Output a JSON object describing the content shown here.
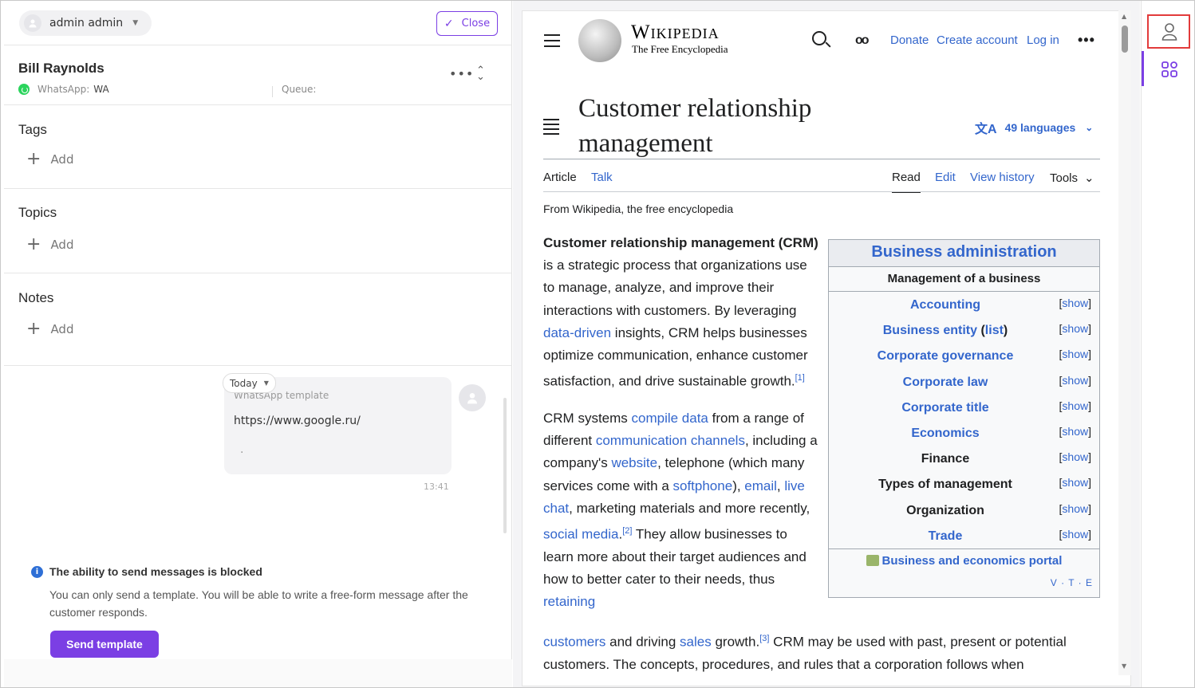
{
  "header": {
    "user_name": "admin admin",
    "close_label": "Close"
  },
  "contact": {
    "name": "Bill Raynolds",
    "channel_label": "WhatsApp:",
    "channel_value": "WA",
    "queue_label": "Queue:"
  },
  "sections": [
    {
      "title": "Tags",
      "add_label": "Add"
    },
    {
      "title": "Topics",
      "add_label": "Add"
    },
    {
      "title": "Notes",
      "add_label": "Add"
    }
  ],
  "chat": {
    "date_chip": "Today",
    "template_label": "WhatsApp template",
    "message_text": "https://www.google.ru/",
    "message_dot": ".",
    "time": "13:41"
  },
  "blocked": {
    "title": "The ability to send messages is blocked",
    "description": "You can only send a template. You will be able to write a free-form message after the customer responds.",
    "button": "Send template"
  },
  "wiki": {
    "wordmark": "Wikipedia",
    "tagline": "The Free Encyclopedia",
    "top_links": [
      "Donate",
      "Create account",
      "Log in"
    ],
    "title": "Customer relationship management",
    "languages": "49 languages",
    "tabs_left": [
      "Article",
      "Talk"
    ],
    "tabs_right": [
      "Read",
      "Edit",
      "View history",
      "Tools"
    ],
    "from": "From Wikipedia, the free encyclopedia",
    "navbox": {
      "title": "Business administration",
      "subtitle": "Management of a business",
      "show_text": "show",
      "rows": [
        {
          "label": "Accounting",
          "linked": true
        },
        {
          "label": "Business entity",
          "extra": "list",
          "linked": true
        },
        {
          "label": "Corporate governance",
          "linked": true
        },
        {
          "label": "Corporate law",
          "linked": true
        },
        {
          "label": "Corporate title",
          "linked": true
        },
        {
          "label": "Economics",
          "linked": true
        },
        {
          "label": "Finance",
          "linked": false
        },
        {
          "label": "Types of management",
          "linked": false
        },
        {
          "label": "Organization",
          "linked": false
        },
        {
          "label": "Trade",
          "linked": true
        }
      ],
      "portal": "Business and economics portal",
      "vte": "V · T · E"
    }
  },
  "colors": {
    "accent": "#7b3fe4",
    "link": "#3366cc",
    "highlight": "#e23b3b"
  }
}
